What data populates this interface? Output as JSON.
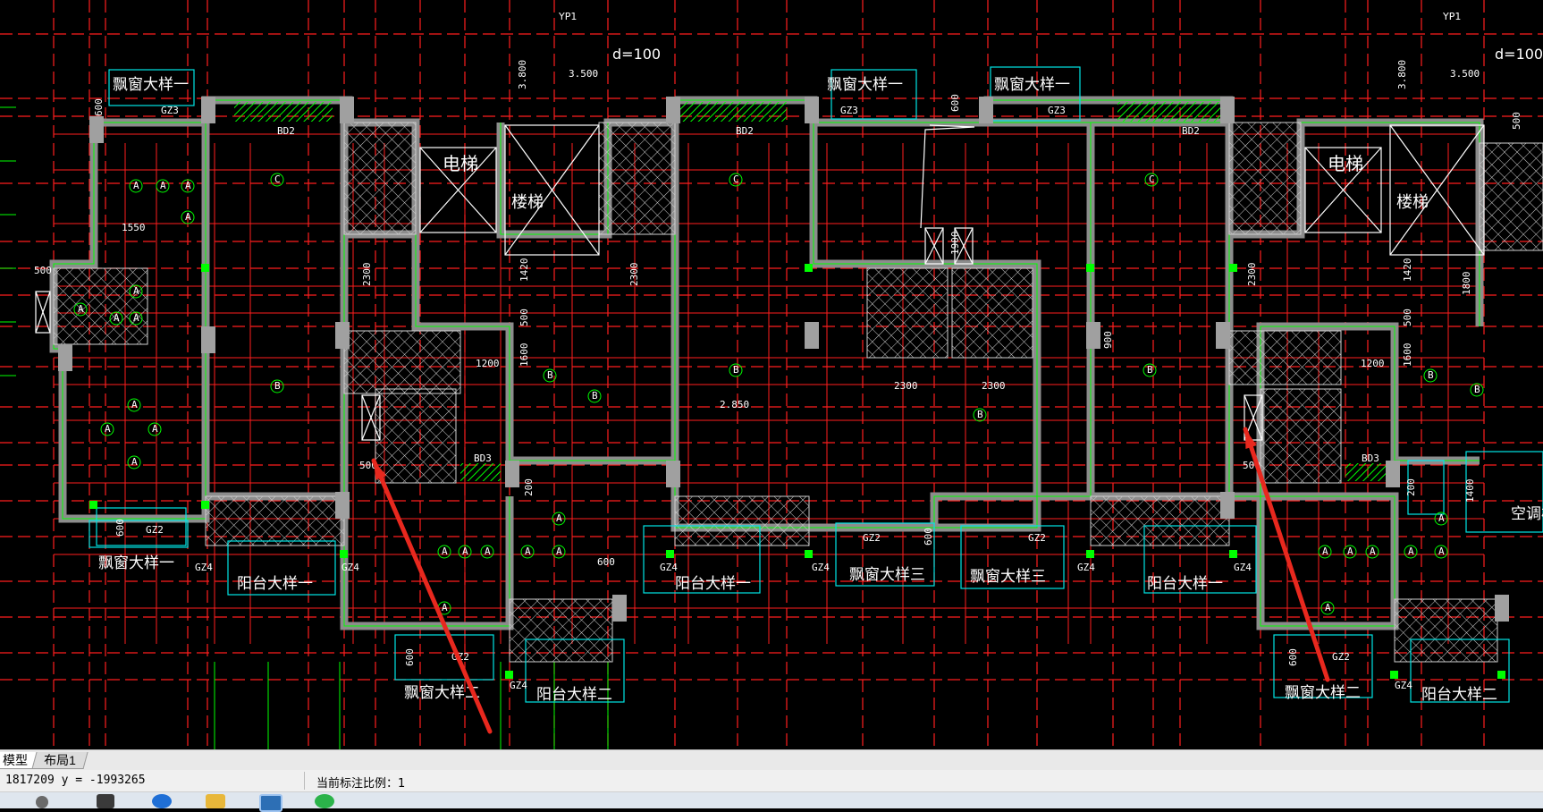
{
  "canvas": {
    "background": "#000000",
    "colors": {
      "axis": "#ff1e1e",
      "wall": "#8c8c8c",
      "wall_edge": "#00ff00",
      "cyan": "#00e5e5",
      "white": "#ffffff",
      "green": "#00ff00",
      "column": "#a0a0a0",
      "arrow": "#e8281e"
    },
    "labels": {
      "bay_window_1": "飘窗大样一",
      "bay_window_2": "飘窗大样二",
      "bay_window_3": "飘窗大样三",
      "balcony_1": "阳台大样一",
      "balcony_2": "阳台大样二",
      "elevator": "电梯",
      "stair": "楼梯",
      "ac_partial": "空调板",
      "yp1": "YP1",
      "d100": "d=100"
    },
    "dims": {
      "d3500": "3.500",
      "d3800": "3.800",
      "d600": "600",
      "d1550": "1550",
      "d500": "500",
      "d2300": "2300",
      "d1420": "1420",
      "d1200": "1200",
      "d1600": "1600",
      "d2850": "2.850",
      "d900": "900",
      "d200": "200",
      "d1800": "1800",
      "d1900": "1900",
      "d1400": "1400"
    },
    "tags": {
      "gz2": "GZ2",
      "gz3": "GZ3",
      "gz4": "GZ4",
      "bd2": "BD2",
      "bd3": "BD3",
      "a": "A",
      "b": "B",
      "c": "C"
    }
  },
  "tabs": {
    "model": "模型",
    "layout1": "布局1"
  },
  "status": {
    "coords": "1817209 y = -1993265",
    "annotation_scale": "当前标注比例：1"
  }
}
